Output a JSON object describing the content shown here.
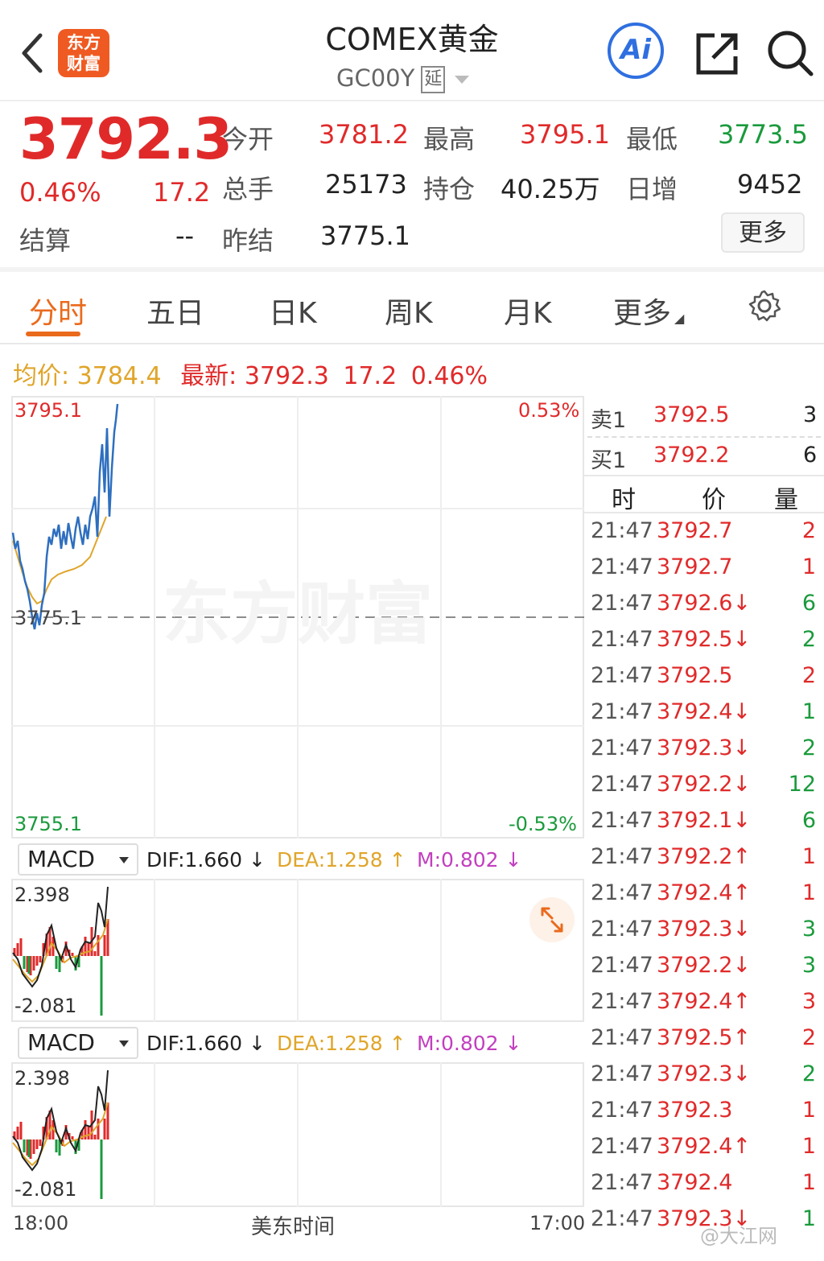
{
  "header": {
    "logo_text_line1": "东方",
    "logo_text_line2": "财富",
    "title": "COMEX黄金",
    "code": "GC00Y",
    "delay_badge": "延",
    "ai_label": "Ai"
  },
  "quote": {
    "last_price": "3792.3",
    "change_pct": "0.46%",
    "change": "17.2",
    "settle_label": "结算",
    "settle_value": "--",
    "open_label": "今开",
    "open_value": "3781.2",
    "high_label": "最高",
    "high_value": "3795.1",
    "low_label": "最低",
    "low_value": "3773.5",
    "volume_label": "总手",
    "volume_value": "25173",
    "oi_label": "持仓",
    "oi_value": "40.25万",
    "daily_inc_label": "日增",
    "daily_inc_value": "9452",
    "prev_settle_label": "昨结",
    "prev_settle_value": "3775.1",
    "more_button": "更多"
  },
  "tabs": [
    {
      "label": "分时",
      "active": true
    },
    {
      "label": "五日",
      "active": false
    },
    {
      "label": "日K",
      "active": false
    },
    {
      "label": "周K",
      "active": false
    },
    {
      "label": "月K",
      "active": false
    },
    {
      "label": "更多",
      "active": false
    }
  ],
  "info_bar": {
    "avg_label": "均价:",
    "avg_value": "3784.4",
    "latest_label": "最新:",
    "latest_value": "3792.3",
    "latest_change": "17.2",
    "latest_pct": "0.46%"
  },
  "chart_axes": {
    "y_top": "3795.1",
    "y_mid": "3775.1",
    "y_bottom": "3755.1",
    "pct_top": "0.53%",
    "pct_bottom": "-0.53%",
    "watermark": "东方财富",
    "x_start": "18:00",
    "x_mid": "美东时间",
    "x_end": "17:00"
  },
  "macd_panels": [
    {
      "selector": "MACD",
      "dif": "DIF:1.660 ↓",
      "dea": "DEA:1.258 ↑",
      "m": "M:0.802 ↓",
      "y_top": "2.398",
      "y_bottom": "-2.081"
    },
    {
      "selector": "MACD",
      "dif": "DIF:1.660 ↓",
      "dea": "DEA:1.258 ↑",
      "m": "M:0.802 ↓",
      "y_top": "2.398",
      "y_bottom": "-2.081"
    }
  ],
  "order_book": {
    "ask_label": "卖1",
    "ask_price": "3792.5",
    "ask_qty": "3",
    "bid_label": "买1",
    "bid_price": "3792.2",
    "bid_qty": "6"
  },
  "trades_header": {
    "time": "时",
    "price": "价",
    "qty": "量"
  },
  "trades": [
    {
      "time": "21:47",
      "price": "3792.7",
      "qty": "2",
      "side": "buy"
    },
    {
      "time": "21:47",
      "price": "3792.7",
      "qty": "1",
      "side": "buy"
    },
    {
      "time": "21:47",
      "price": "3792.6↓",
      "qty": "6",
      "side": "sell"
    },
    {
      "time": "21:47",
      "price": "3792.5↓",
      "qty": "2",
      "side": "sell"
    },
    {
      "time": "21:47",
      "price": "3792.5",
      "qty": "2",
      "side": "buy"
    },
    {
      "time": "21:47",
      "price": "3792.4↓",
      "qty": "1",
      "side": "sell"
    },
    {
      "time": "21:47",
      "price": "3792.3↓",
      "qty": "2",
      "side": "sell"
    },
    {
      "time": "21:47",
      "price": "3792.2↓",
      "qty": "12",
      "side": "sell"
    },
    {
      "time": "21:47",
      "price": "3792.1↓",
      "qty": "6",
      "side": "sell"
    },
    {
      "time": "21:47",
      "price": "3792.2↑",
      "qty": "1",
      "side": "buy"
    },
    {
      "time": "21:47",
      "price": "3792.4↑",
      "qty": "1",
      "side": "buy"
    },
    {
      "time": "21:47",
      "price": "3792.3↓",
      "qty": "3",
      "side": "sell"
    },
    {
      "time": "21:47",
      "price": "3792.2↓",
      "qty": "3",
      "side": "sell"
    },
    {
      "time": "21:47",
      "price": "3792.4↑",
      "qty": "3",
      "side": "buy"
    },
    {
      "time": "21:47",
      "price": "3792.5↑",
      "qty": "2",
      "side": "buy"
    },
    {
      "time": "21:47",
      "price": "3792.3↓",
      "qty": "2",
      "side": "sell"
    },
    {
      "time": "21:47",
      "price": "3792.3",
      "qty": "1",
      "side": "buy"
    },
    {
      "time": "21:47",
      "price": "3792.4↑",
      "qty": "1",
      "side": "buy"
    },
    {
      "time": "21:47",
      "price": "3792.4",
      "qty": "1",
      "side": "buy"
    },
    {
      "time": "21:47",
      "price": "3792.3↓",
      "qty": "1",
      "side": "sell"
    }
  ],
  "footer_watermark": "@大江网",
  "colors": {
    "up": "#e02a2a",
    "down": "#1a9a3c",
    "accent": "#ea6a1c",
    "ai_blue": "#2f6fe0",
    "price_line": "#2e6fbf",
    "avg_line": "#e0a52a"
  },
  "icons": {
    "back": "chevron-left-icon",
    "share": "share-icon",
    "search": "search-icon",
    "settings": "gear-icon",
    "expand": "expand-icon"
  }
}
